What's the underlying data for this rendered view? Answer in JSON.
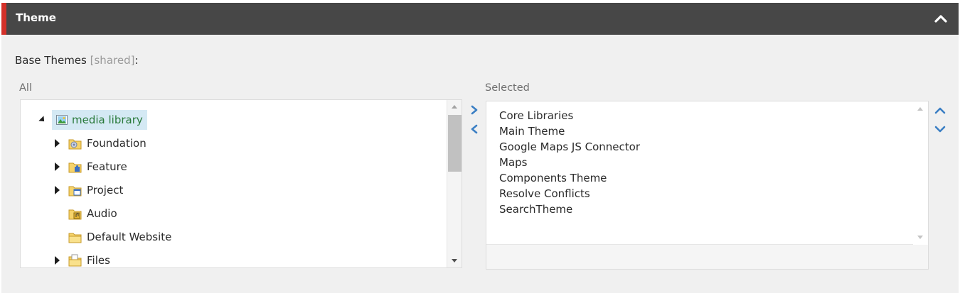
{
  "header": {
    "title": "Theme",
    "collapse_icon": "chevron-up-icon"
  },
  "field": {
    "label": "Base Themes",
    "shared": "[shared]",
    "colon": ":"
  },
  "all_column": {
    "label": "All"
  },
  "selected_column": {
    "label": "Selected"
  },
  "tree": {
    "root": {
      "label": "media library",
      "icon": "image-icon",
      "expanded": true,
      "selected": true
    },
    "children": [
      {
        "label": "Foundation",
        "icon": "folder-gear-icon",
        "expandable": true
      },
      {
        "label": "Feature",
        "icon": "folder-puzzle-icon",
        "expandable": true
      },
      {
        "label": "Project",
        "icon": "folder-window-icon",
        "expandable": true
      },
      {
        "label": "Audio",
        "icon": "folder-audio-icon",
        "expandable": false
      },
      {
        "label": "Default Website",
        "icon": "folder-icon",
        "expandable": false
      },
      {
        "label": "Files",
        "icon": "folder-files-icon",
        "expandable": true
      }
    ]
  },
  "selected_items": [
    "Core Libraries",
    "Main Theme",
    "Google Maps JS Connector",
    "Maps",
    "Components Theme",
    "Resolve Conflicts",
    "SearchTheme"
  ],
  "colors": {
    "accent": "#d33029",
    "header_bg": "#474747",
    "link_blue": "#3b7fc4",
    "selected_bg": "#d4e9f4",
    "selected_text": "#2a7a3b"
  }
}
